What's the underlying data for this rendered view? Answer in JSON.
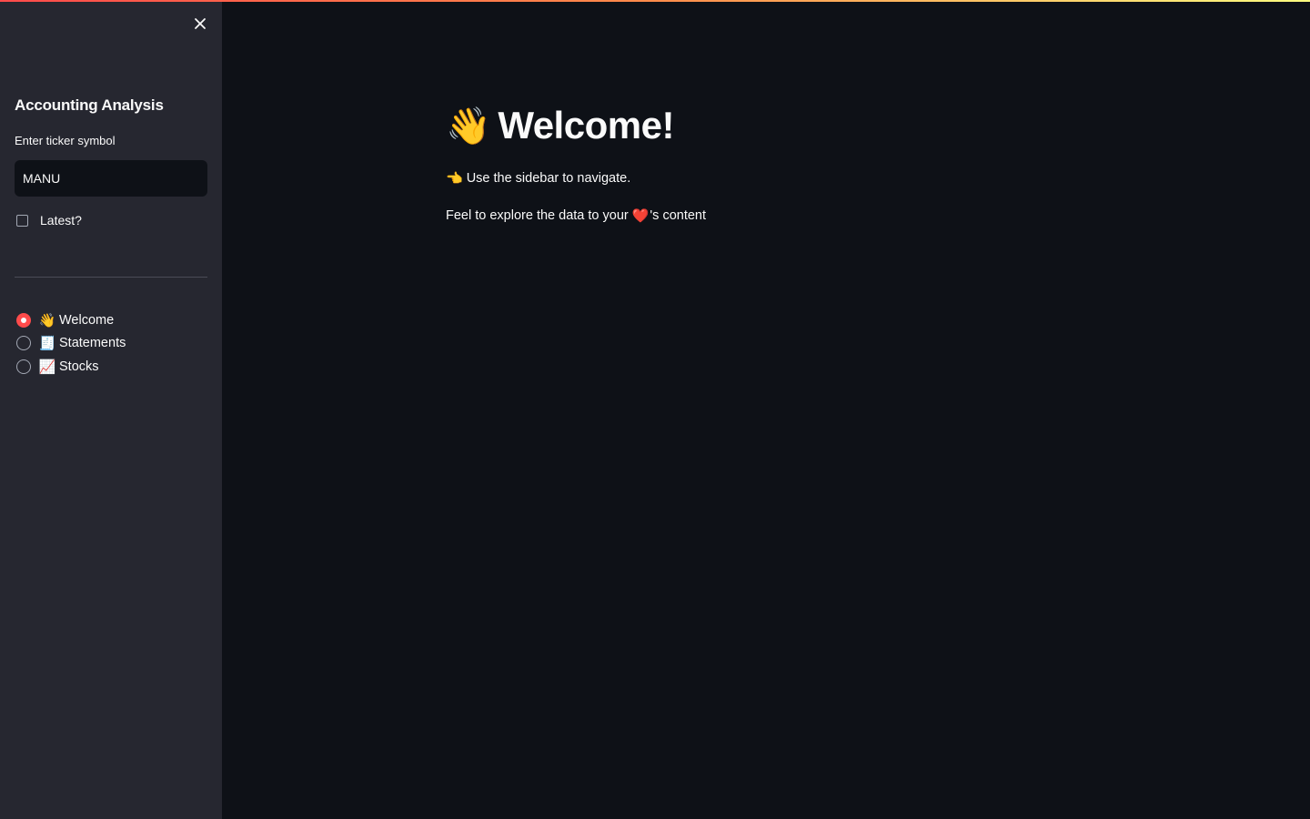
{
  "sidebar": {
    "close_icon": "close-icon",
    "title": "Accounting Analysis",
    "ticker_label": "Enter ticker symbol",
    "ticker_value": "MANU",
    "checkbox_label": "Latest?",
    "checkbox_checked": false,
    "nav_items": [
      {
        "emoji": "👋",
        "label": "Welcome",
        "selected": true
      },
      {
        "emoji": "🧾",
        "label": "Statements",
        "selected": false
      },
      {
        "emoji": "📈",
        "label": "Stocks",
        "selected": false
      }
    ]
  },
  "main": {
    "heading_emoji": "👋",
    "heading": "Welcome!",
    "para1_emoji": "👈",
    "para1_text": "Use the sidebar to navigate.",
    "para2_before": "Feel to explore the data to your",
    "para2_heart": "❤️",
    "para2_after": "'s content"
  },
  "colors": {
    "accent": "#ff4b4b",
    "background": "#0e1117",
    "sidebar_background": "#262730",
    "text": "#fafafa"
  }
}
